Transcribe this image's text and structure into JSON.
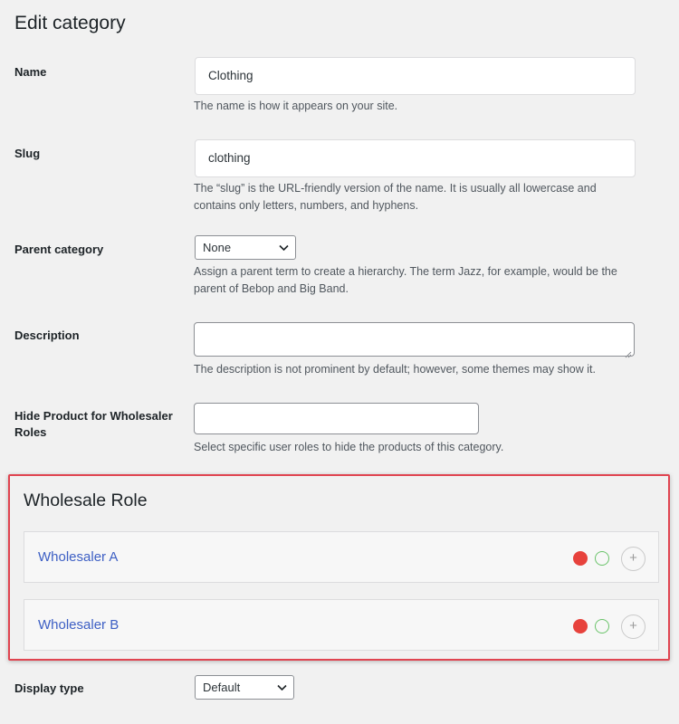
{
  "page": {
    "title": "Edit category"
  },
  "form": {
    "name": {
      "label": "Name",
      "value": "Clothing",
      "help": "The name is how it appears on your site."
    },
    "slug": {
      "label": "Slug",
      "value": "clothing",
      "help_line1": "The “slug” is the URL-friendly version of the name. It is usually all lowercase and",
      "help_line2": "contains only letters, numbers, and hyphens."
    },
    "parent": {
      "label": "Parent category",
      "selected": "None",
      "help_line1": "Assign a parent term to create a hierarchy. The term Jazz, for example, would be the",
      "help_line2": "parent of Bebop and Big Band."
    },
    "description": {
      "label": "Description",
      "value": "",
      "help": "The description is not prominent by default; however, some themes may show it."
    },
    "hide_product": {
      "label_line1": "Hide Product for Wholesaler",
      "label_line2": "Roles",
      "value": "",
      "help": "Select specific user roles to hide the products of this category."
    },
    "display_type": {
      "label": "Display type",
      "selected": "Default"
    }
  },
  "wholesale": {
    "title": "Wholesale Role",
    "roles": [
      {
        "name": "Wholesaler A",
        "plus": "+"
      },
      {
        "name": "Wholesaler B",
        "plus": "+"
      }
    ],
    "colors": {
      "highlight_border": "#e04450",
      "link": "#3d5fc4",
      "status_red": "#e7423c",
      "status_green": "#6ac36a"
    }
  }
}
